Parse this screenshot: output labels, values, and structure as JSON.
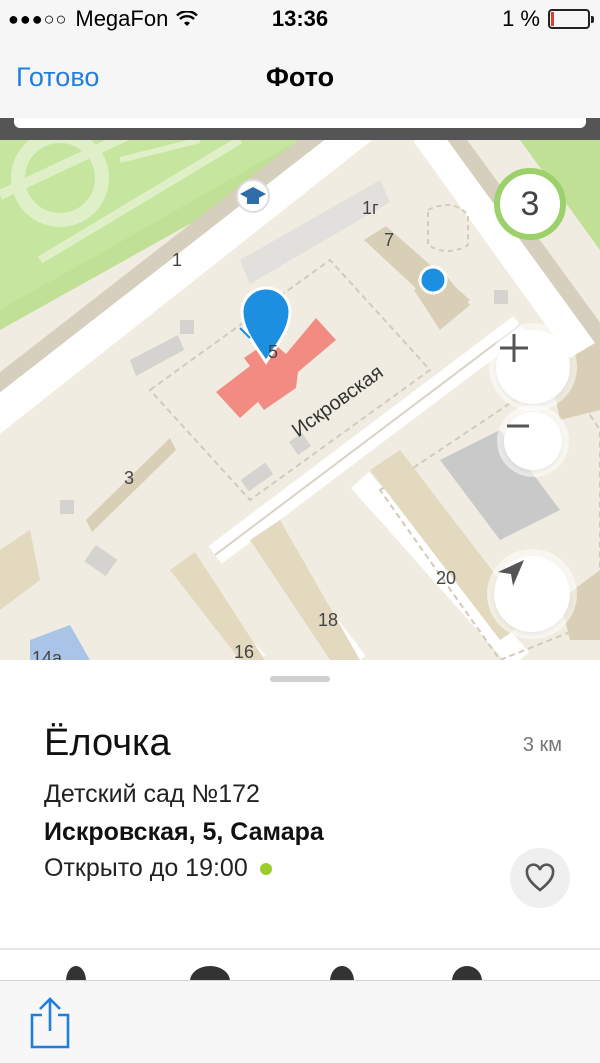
{
  "status_bar": {
    "carrier": "MegaFon",
    "signal_dots": "●●●○○",
    "time": "13:36",
    "battery_percent": "1 %",
    "battery_level": 0.01
  },
  "nav": {
    "done_label": "Готово",
    "title": "Фото"
  },
  "map": {
    "street_name": "Искровская",
    "cluster_count": "3",
    "building_numbers": [
      "1",
      "1г",
      "7",
      "5",
      "3",
      "20",
      "18",
      "16",
      "14а"
    ],
    "colors": {
      "park": "#b9dd8c",
      "selected_building": "#f28c82",
      "marker": "#1d8fe0",
      "user_location": "#1d8fe0"
    },
    "icons": [
      "education-icon",
      "zoom-in-icon",
      "zoom-out-icon",
      "locate-arrow-icon"
    ]
  },
  "place": {
    "name": "Ёлочка",
    "distance": "3 км",
    "category": "Детский сад №172",
    "address": "Искровская, 5, Самара",
    "hours": "Открыто до 19:00",
    "open_status_color": "#9ccc2b"
  },
  "toolbar": {
    "icons": [
      "share-icon"
    ]
  }
}
